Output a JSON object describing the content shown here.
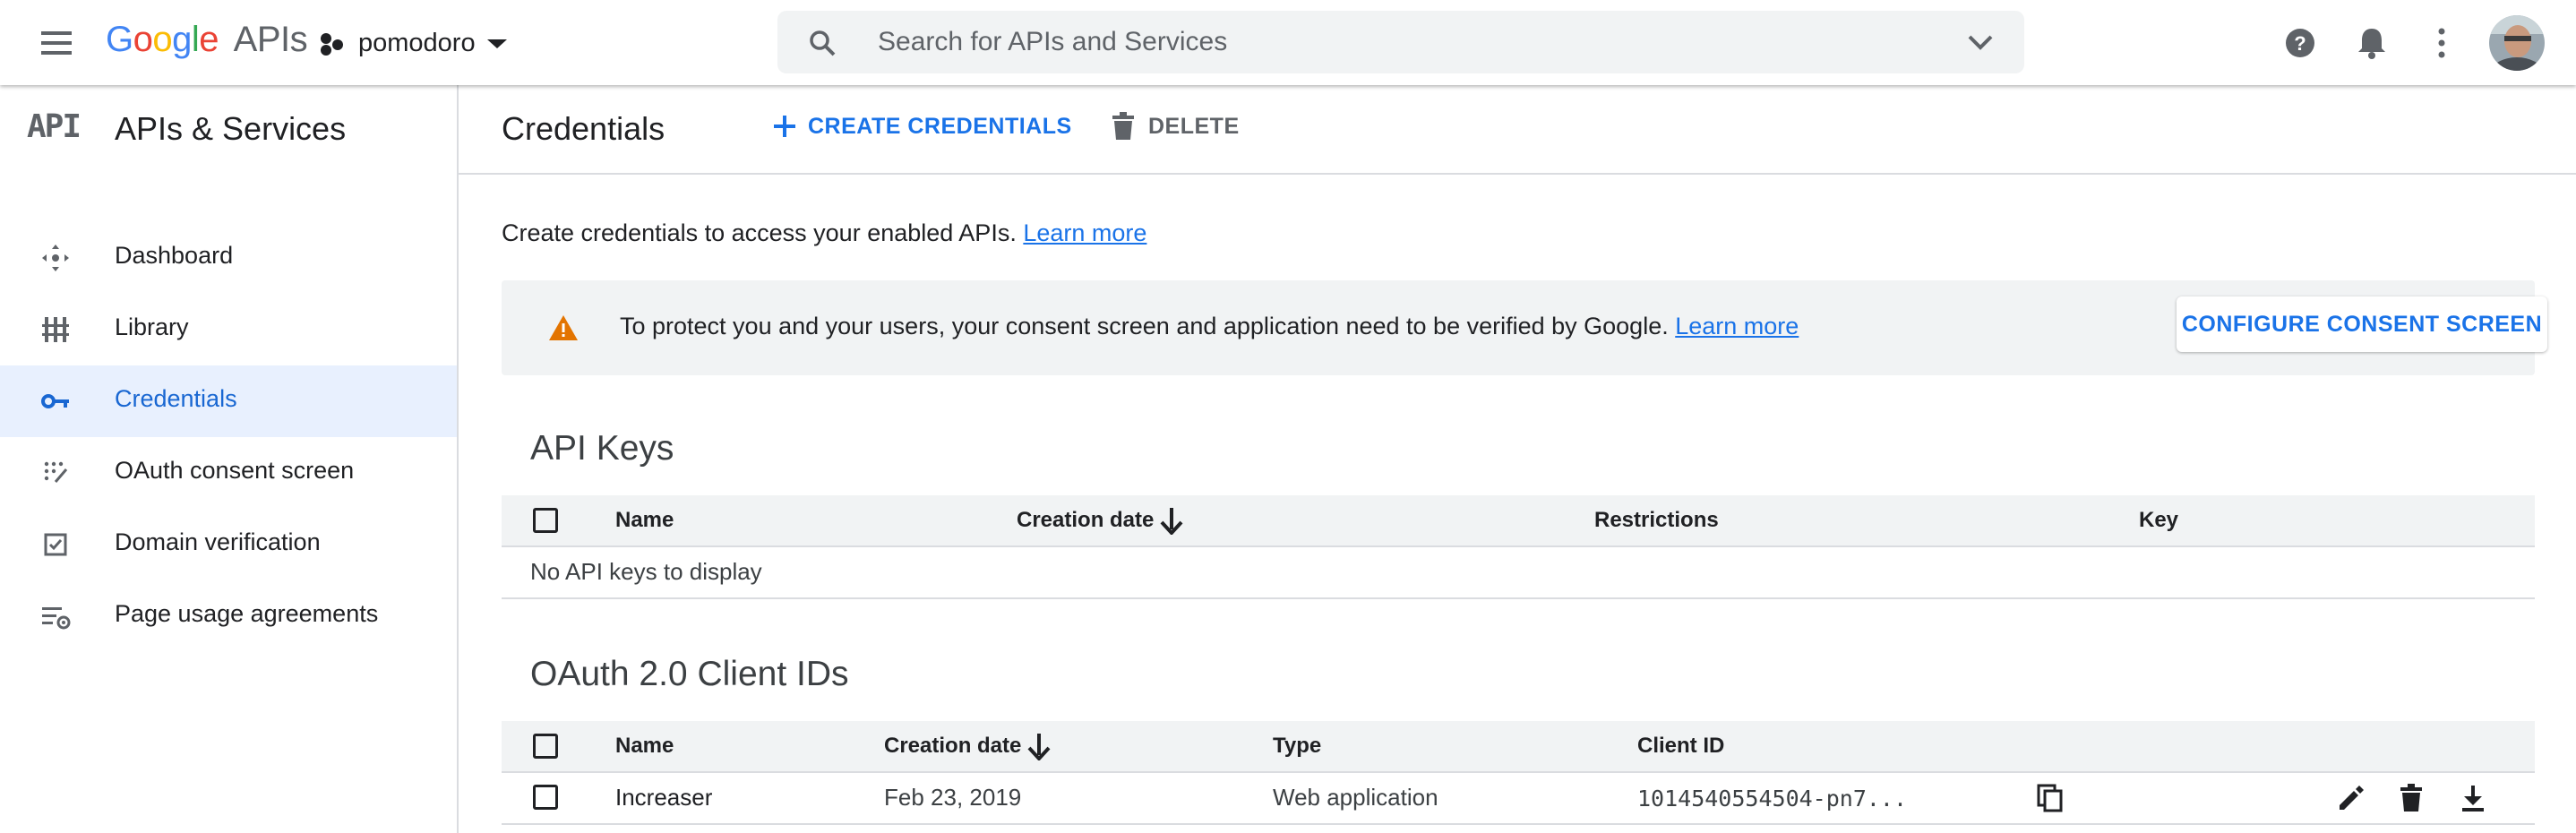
{
  "topbar": {
    "logo_google": [
      "G",
      "o",
      "o",
      "g",
      "l",
      "e"
    ],
    "logo_apis": "APIs",
    "project": "pomodoro",
    "search_placeholder": "Search for APIs and Services"
  },
  "sidebar": {
    "badge": "API",
    "title": "APIs & Services",
    "items": [
      {
        "label": "Dashboard",
        "icon": "dashboard-icon"
      },
      {
        "label": "Library",
        "icon": "library-icon"
      },
      {
        "label": "Credentials",
        "icon": "key-icon",
        "active": true
      },
      {
        "label": "OAuth consent screen",
        "icon": "consent-icon"
      },
      {
        "label": "Domain verification",
        "icon": "verified-checkbox-icon"
      },
      {
        "label": "Page usage agreements",
        "icon": "settings-list-icon"
      }
    ]
  },
  "main": {
    "title": "Credentials",
    "create_label": "CREATE CREDENTIALS",
    "delete_label": "DELETE",
    "intro_text": "Create credentials to access your enabled APIs.",
    "intro_link": "Learn more",
    "banner": {
      "text": "To protect you and your users, your consent screen and application need to be verified by Google.",
      "link": "Learn more",
      "button": "CONFIGURE CONSENT SCREEN"
    },
    "api_keys": {
      "title": "API Keys",
      "columns": [
        "Name",
        "Creation date",
        "Restrictions",
        "Key"
      ],
      "empty": "No API keys to display"
    },
    "oauth": {
      "title": "OAuth 2.0 Client IDs",
      "columns": [
        "Name",
        "Creation date",
        "Type",
        "Client ID"
      ],
      "rows": [
        {
          "name": "Increaser",
          "date": "Feb 23, 2019",
          "type": "Web application",
          "client_id": "1014540554504-pn7..."
        }
      ]
    }
  },
  "colors": {
    "accent": "#1a73e8",
    "active_bg": "#e8f0fe",
    "warning": "#e37400",
    "google_blue": "#4285f4",
    "google_red": "#ea4335",
    "google_yellow": "#fbbc05",
    "google_green": "#34a853"
  }
}
